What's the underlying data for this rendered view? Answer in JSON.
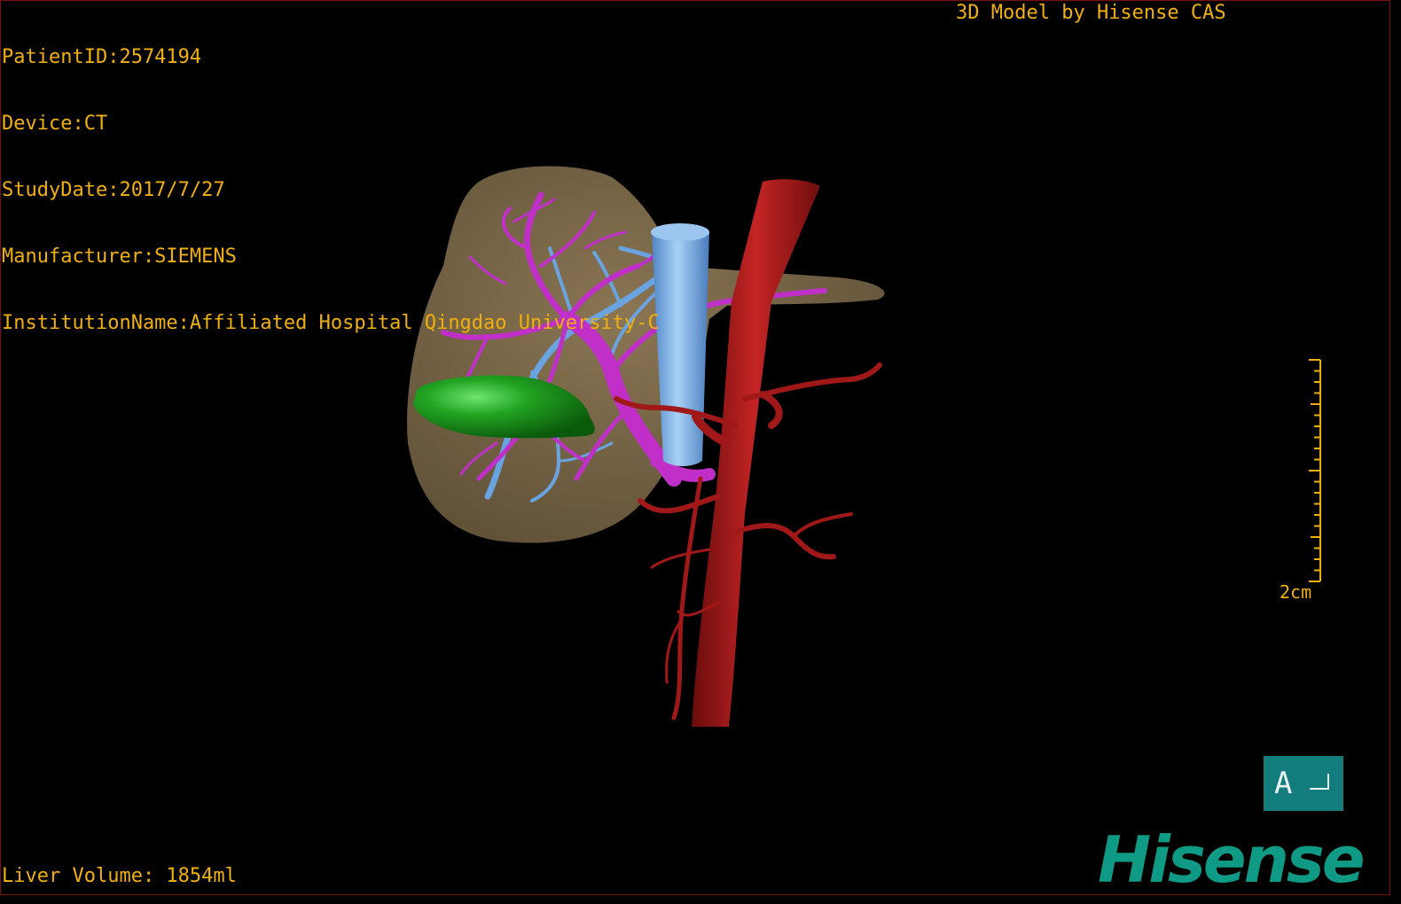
{
  "patient_info": {
    "patient_id": "PatientID:2574194",
    "device": "Device:CT",
    "study_date": "StudyDate:2017/7/27",
    "manufacturer": "Manufacturer:SIEMENS",
    "institution": "InstitutionName:Affiliated Hospital Qingdao University-C"
  },
  "model_label": "3D Model by Hisense CAS",
  "liver_volume": "Liver Volume: 1854ml",
  "scale_bar": {
    "label": "2cm"
  },
  "orientation": {
    "label": "A"
  },
  "brand": "Hisense",
  "colors": {
    "overlay_text": "#f0b010",
    "liver": "#7d6a4a",
    "gallbladder": "#1e9a1e",
    "portal_vein": "#c030c8",
    "hepatic_vein": "#6aa4e0",
    "ivc": "#7ab0e8",
    "artery": "#a01818",
    "orientation_cube": "#137c7c",
    "brand": "#0f9a86"
  }
}
